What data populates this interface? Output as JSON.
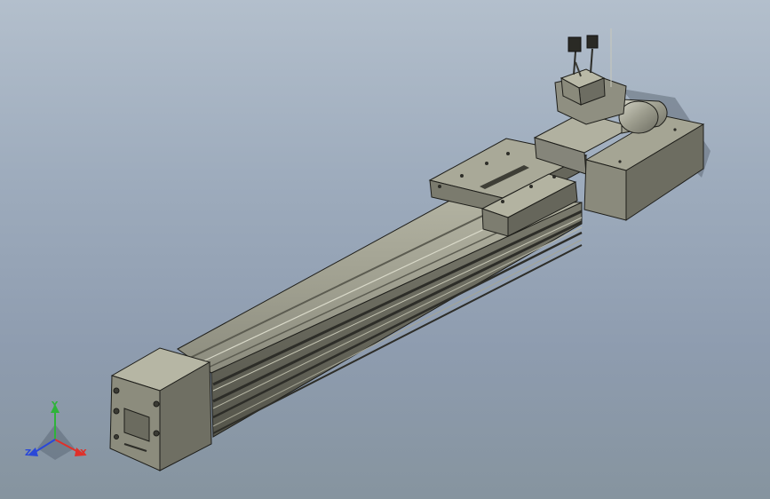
{
  "viewport": {
    "model": "linear-actuator-assembly",
    "background_top": "#b3bfcc",
    "background_bottom": "#86949f"
  },
  "triad": {
    "x_label": "X",
    "y_label": "Y",
    "z_label": "Z",
    "x_color": "#e0302a",
    "y_color": "#2fb33a",
    "z_color": "#2a48d8"
  },
  "part_colors": {
    "body": "#8f8f82",
    "body_light": "#a8a897",
    "body_dark": "#5e5e55",
    "edge": "#1e1e1a"
  }
}
